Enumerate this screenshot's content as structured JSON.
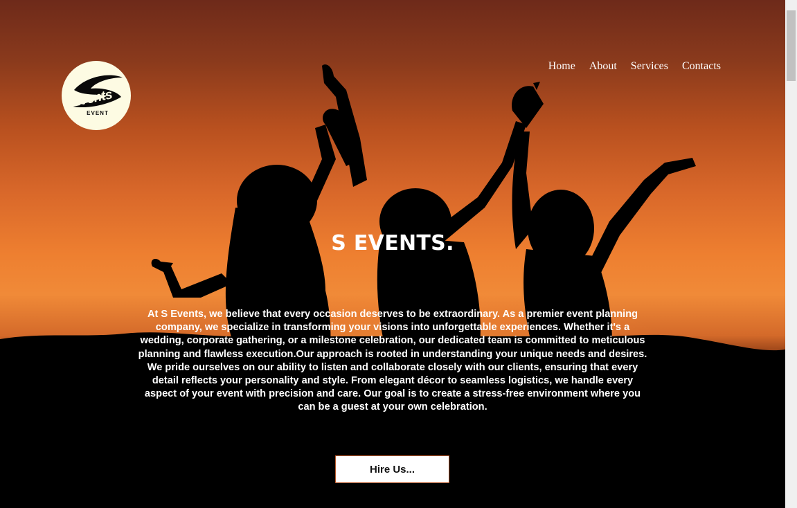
{
  "logo": {
    "word": "Events",
    "sub": "EVENT"
  },
  "nav": {
    "home": "Home",
    "about": "About",
    "services": "Services",
    "contacts": "Contacts"
  },
  "hero": {
    "title": "S EVENTS.",
    "description": "At S Events, we believe that every occasion deserves to be extraordinary. As a premier event planning company, we specialize in transforming your visions into unforgettable experiences. Whether it's a wedding, corporate gathering, or a milestone celebration, our dedicated team is committed to meticulous planning and flawless execution.Our approach is rooted in understanding your unique needs and desires. We pride ourselves on our ability to listen and collaborate closely with our clients, ensuring that every detail reflects your personality and style. From elegant décor to seamless logistics, we handle every aspect of your event with precision and care. Our goal is to create a stress-free environment where you can be a guest at your own celebration.",
    "cta": "Hire Us..."
  },
  "colors": {
    "sky_top": "#6e2a1a",
    "sky_mid": "#ee7f30",
    "logo_bg": "#fdfbe3",
    "cta_border": "#b5572a"
  }
}
